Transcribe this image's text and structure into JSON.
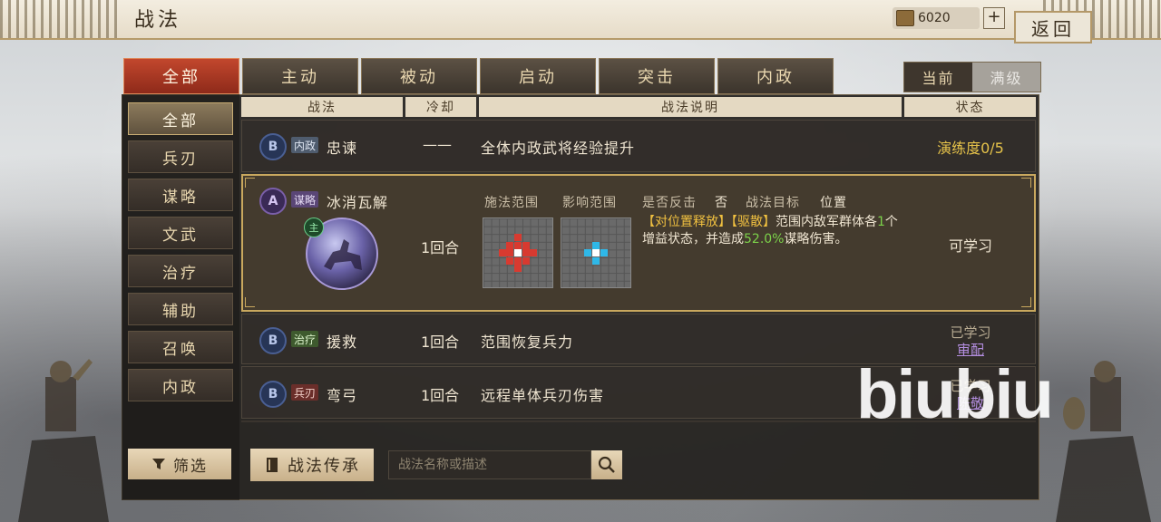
{
  "header": {
    "title": "战法",
    "currency": "6020",
    "plus_label": "+",
    "back_label": "返回"
  },
  "tabs": [
    {
      "label": "全部",
      "active": true
    },
    {
      "label": "主动",
      "active": false
    },
    {
      "label": "被动",
      "active": false
    },
    {
      "label": "启动",
      "active": false
    },
    {
      "label": "突击",
      "active": false
    },
    {
      "label": "内政",
      "active": false
    }
  ],
  "level_toggle": {
    "current": "当前",
    "max": "满级"
  },
  "sidebar": {
    "items": [
      "全部",
      "兵刃",
      "谋略",
      "文武",
      "治疗",
      "辅助",
      "召唤",
      "内政"
    ],
    "filter_label": "筛选"
  },
  "table": {
    "headers": {
      "name": "战法",
      "cooldown": "冷却",
      "description": "战法说明",
      "status": "状态"
    },
    "rows": [
      {
        "grade": "B",
        "type": "内政",
        "name": "忠谏",
        "cooldown": "——",
        "description": "全体内政武将经验提升",
        "status": "演练度0/5"
      },
      {
        "grade": "A",
        "type": "谋略",
        "name": "冰消瓦解",
        "cooldown": "1回合",
        "cast_range_label": "施法范围",
        "effect_range_label": "影响范围",
        "counter_label": "是否反击",
        "counter_value": "否",
        "target_label": "战法目标",
        "target_value": "位置",
        "effect_tag1": "【对位置释放】",
        "effect_tag2": "【驱散】",
        "effect_text1": "范围内敌军群体各",
        "effect_num1": "1",
        "effect_text2": "个增益状态，并造成",
        "effect_num2": "52.0%",
        "effect_text3": "谋略伤害。",
        "lord_badge": "主",
        "status": "可学习"
      },
      {
        "grade": "B",
        "type": "治疗",
        "name": "援救",
        "cooldown": "1回合",
        "description": "范围恢复兵力",
        "status": "已学习",
        "status_sub": "审配"
      },
      {
        "grade": "B",
        "type": "兵刃",
        "name": "弯弓",
        "cooldown": "1回合",
        "description": "远程单体兵刃伤害",
        "status": "已学习",
        "status_sub": "陈敬"
      }
    ]
  },
  "bottom": {
    "inherit_label": "战法传承",
    "search_placeholder": "战法名称或描述"
  },
  "watermark": "biubiu"
}
